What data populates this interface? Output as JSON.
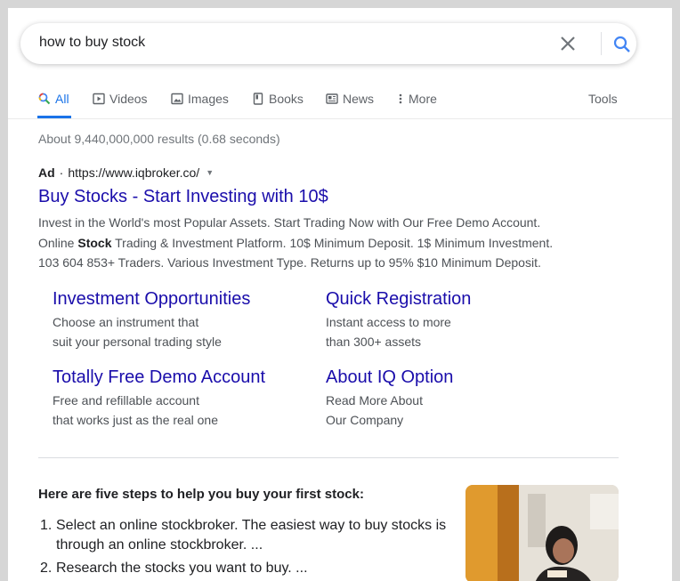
{
  "search": {
    "query": "how to buy stock"
  },
  "tabs": [
    {
      "label": "All",
      "icon": "search-icon"
    },
    {
      "label": "Videos",
      "icon": "video-icon"
    },
    {
      "label": "Images",
      "icon": "image-icon"
    },
    {
      "label": "Books",
      "icon": "book-icon"
    },
    {
      "label": "News",
      "icon": "newspaper-icon"
    },
    {
      "label": "More",
      "icon": "more-vert-icon"
    }
  ],
  "tools_label": "Tools",
  "results_stats": "About 9,440,000,000 results (0.68 seconds)",
  "ad": {
    "label": "Ad",
    "separator": "·",
    "url": "https://www.iqbroker.co/",
    "title": "Buy Stocks - Start Investing with 10$",
    "desc_line1": "Invest in the World's most Popular Assets. Start Trading Now with Our Free Demo Account.",
    "desc_line2_pre": "Online ",
    "desc_line2_bold": "Stock",
    "desc_line2_post": " Trading & Investment Platform. 10$ Minimum Deposit. 1$ Minimum Investment.",
    "desc_line3": "103 604 853+ Traders. Various Investment Type. Returns up to 95% $10 Minimum Deposit."
  },
  "sitelinks": [
    {
      "title": "Investment Opportunities",
      "line1": "Choose an instrument that",
      "line2": "suit your personal trading style"
    },
    {
      "title": "Quick Registration",
      "line1": "Instant access to more",
      "line2": "than 300+ assets"
    },
    {
      "title": "Totally Free Demo Account",
      "line1": "Free and refillable account",
      "line2": "that works just as the real one"
    },
    {
      "title": "About IQ Option",
      "line1": "Read More About",
      "line2": "Our Company"
    }
  ],
  "snippet": {
    "heading": "Here are five steps to help you buy your first stock:",
    "steps": [
      {
        "num": "1.",
        "text": "Select an online stockbroker. The easiest way to buy stocks is through an online stockbroker. ..."
      },
      {
        "num": "2.",
        "text": "Research the stocks you want to buy. ..."
      }
    ]
  },
  "colors": {
    "link": "#1a0dab",
    "accent": "#1a73e8",
    "text": "#202124",
    "muted": "#70757a"
  }
}
